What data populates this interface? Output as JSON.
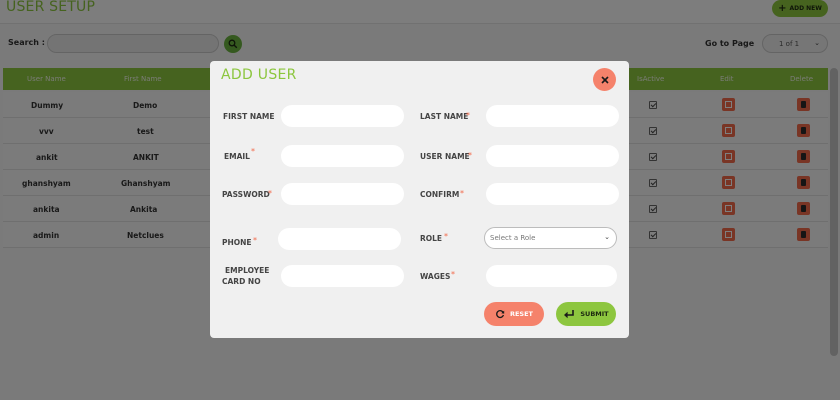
{
  "header": {
    "title": "USER SETUP",
    "add_new_label": "ADD NEW"
  },
  "search": {
    "label": "Search :",
    "value": ""
  },
  "pagination": {
    "goto_label": "Go to Page",
    "selected": "1 of 1"
  },
  "table": {
    "columns": [
      "User Name",
      "First Name",
      "IsActive",
      "Edit",
      "Delete"
    ],
    "rows": [
      {
        "user_name": "Dummy",
        "first_name": "Demo"
      },
      {
        "user_name": "vvv",
        "first_name": "test"
      },
      {
        "user_name": "ankit",
        "first_name": "ANKIT"
      },
      {
        "user_name": "ghanshyam",
        "first_name": "Ghanshyam"
      },
      {
        "user_name": "ankita",
        "first_name": "Ankita"
      },
      {
        "user_name": "admin",
        "first_name": "Netclues"
      }
    ]
  },
  "modal": {
    "title": "ADD USER",
    "fields": {
      "first_name": "FIRST NAME",
      "last_name": "LAST NAME",
      "email": "EMAIL",
      "user_name": "USER NAME",
      "password": "PASSWORD",
      "confirm": "CONFIRM",
      "phone": "PHONE",
      "role": "ROLE",
      "employee_card_line1": "EMPLOYEE",
      "employee_card_line2": "CARD NO",
      "wages": "WAGES"
    },
    "required_mark": "*",
    "role_placeholder": "Select a Role",
    "reset_label": "RESET",
    "submit_label": "SUBMIT"
  },
  "colors": {
    "accent": "#8dc63f",
    "danger": "#f5826b"
  }
}
